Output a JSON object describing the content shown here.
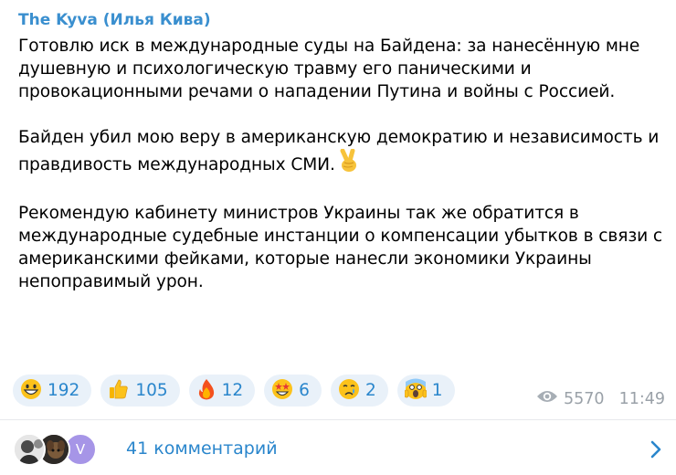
{
  "post": {
    "channel_name": "The Kyva (Илья Кива)",
    "paragraph1": "Готовлю иск в международные суды на Байдена: за нанесённую мне душевную и психологическую травму его паническими и провокационными речами  о нападении Путина и войны с Россией.",
    "paragraph2": "Байден убил мою веру в американскую демократию и независимость и правдивость международных СМИ.",
    "paragraph2_emoji": "victory-hand-emoji",
    "paragraph3": "Рекомендую кабинету министров Украины так же обратится в международные судебные инстанции о компенсации убытков в связи с американскими фейками, которые нанесли экономики Украины непоправимый урон."
  },
  "reactions": [
    {
      "icon": "grinning-face-emoji",
      "count": "192"
    },
    {
      "icon": "thumbs-up-emoji",
      "count": "105"
    },
    {
      "icon": "fire-emoji",
      "count": "12"
    },
    {
      "icon": "star-struck-emoji",
      "count": "6"
    },
    {
      "icon": "crying-face-emoji",
      "count": "2"
    },
    {
      "icon": "screaming-face-emoji",
      "count": "1"
    }
  ],
  "meta": {
    "views": "5570",
    "time": "11:49",
    "views_icon": "eye-icon"
  },
  "comments": {
    "label": "41 комментарий",
    "avatar3_letter": "V",
    "chevron_icon": "chevron-right-icon"
  },
  "colors": {
    "accent": "#2a86cc",
    "channel_name": "#3a8fcf",
    "reaction_bg": "#e9f1f9",
    "meta": "#9aa1a8"
  }
}
